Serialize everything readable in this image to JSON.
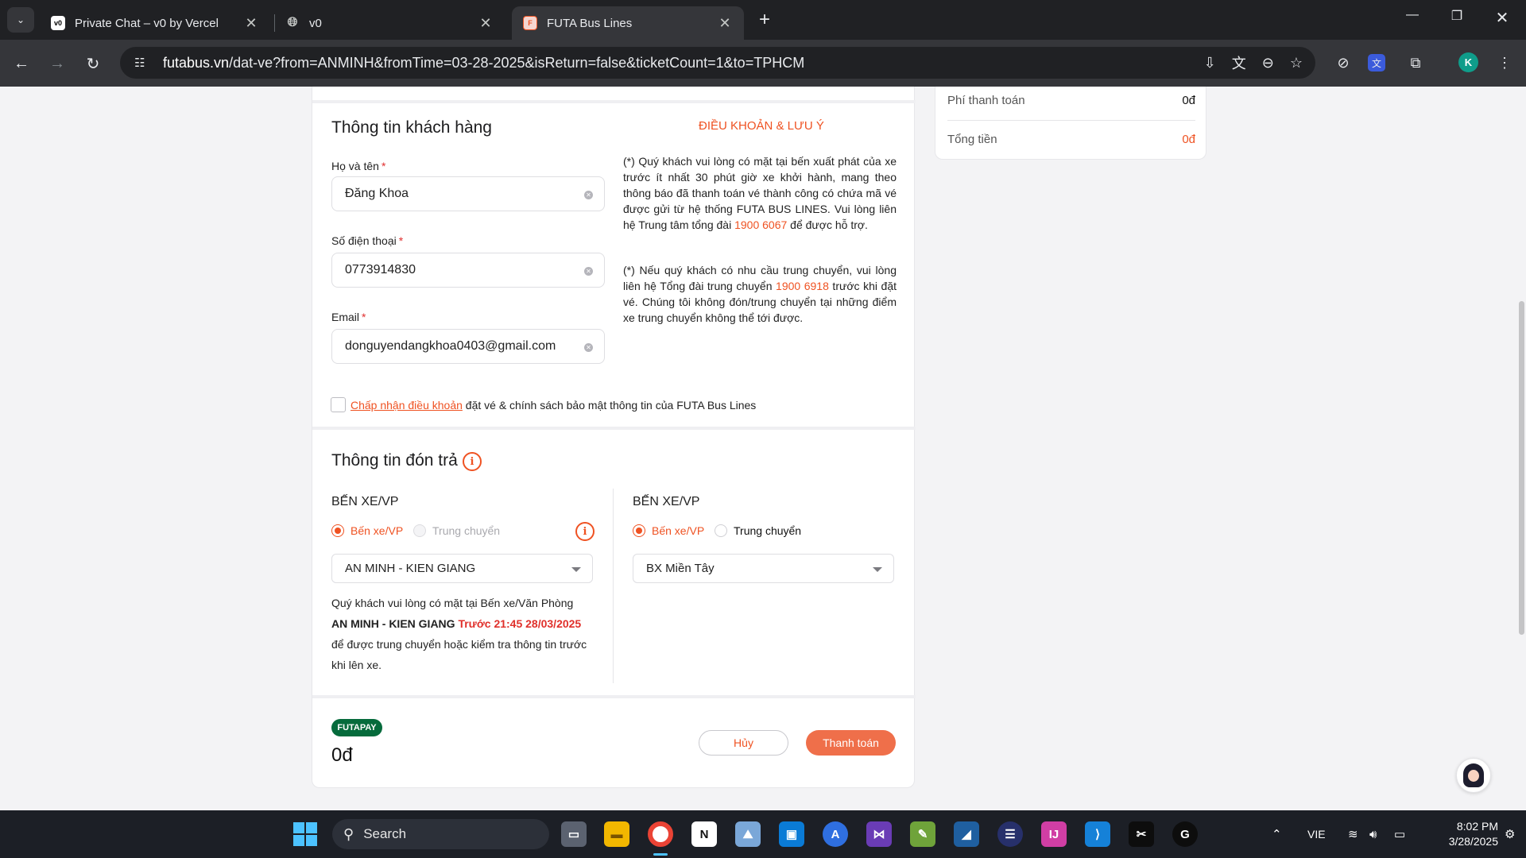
{
  "browser": {
    "tabs": [
      {
        "title": "Private Chat – v0 by Vercel",
        "favicon": "v0",
        "active": false
      },
      {
        "title": "v0",
        "favicon": "globe-icon",
        "active": false
      },
      {
        "title": "FUTA Bus Lines",
        "favicon": "futa-icon",
        "active": true
      }
    ],
    "url_host": "futabus.vn",
    "url_path": "/dat-ve?from=ANMINH&fromTime=03-28-2025&isReturn=false&ticketCount=1&to=TPHCM",
    "profile_initial": "K"
  },
  "customer": {
    "title": "Thông tin khách hàng",
    "name_label": "Họ và tên",
    "name_value": "Đăng Khoa",
    "phone_label": "Số điện thoại",
    "phone_value": "0773914830",
    "email_label": "Email",
    "email_value": "donguyendangkhoa0403@gmail.com",
    "required_mark": "*"
  },
  "terms": {
    "title": "ĐIỀU KHOẢN & LƯU Ý",
    "p1_before": "(*) Quý khách vui lòng có mặt tại bến xuất phát của xe trước ít nhất 30 phút giờ xe khởi hành, mang theo thông báo đã thanh toán vé thành công có chứa mã vé được gửi từ hệ thống FUTA BUS LINES. Vui lòng liên hệ Trung tâm tổng đài ",
    "p1_phone": "1900 6067",
    "p1_after": " để được hỗ trợ.",
    "p2_before": "(*) Nếu quý khách có nhu cầu trung chuyển, vui lòng liên hệ Tổng đài trung chuyển ",
    "p2_phone": "1900 6918",
    "p2_after": " trước khi đặt vé. Chúng tôi không đón/trung chuyển tại những điểm xe trung chuyển không thể tới được.",
    "agree_link": "Chấp nhận điều khoản",
    "agree_rest": " đặt vé & chính sách bảo mật thông tin của FUTA Bus Lines"
  },
  "pickup": {
    "title": "Thông tin đón trả",
    "left": {
      "heading": "BẾN XE/VP",
      "option_station": "Bến xe/VP",
      "option_transfer": "Trung chuyển",
      "selected": "AN MINH - KIEN GIANG",
      "note_line1": "Quý khách vui lòng có mặt tại Bến xe/Văn Phòng",
      "note_station": "AN MINH - KIEN GIANG",
      "note_time": "Trước 21:45 28/03/2025",
      "note_line3": "để được trung chuyển hoặc kiểm tra thông tin trước khi lên xe."
    },
    "right": {
      "heading": "BẾN XE/VP",
      "option_station": "Bến xe/VP",
      "option_transfer": "Trung chuyển",
      "selected": "BX Miền Tây"
    }
  },
  "payment": {
    "badge": "FUTAPAY",
    "amount": "0đ",
    "cancel_label": "Hủy",
    "pay_label": "Thanh toán"
  },
  "summary": {
    "fee_label": "Phí thanh toán",
    "fee_value": "0đ",
    "total_label": "Tổng tiền",
    "total_value": "0đ"
  },
  "taskbar": {
    "search_label": "Search",
    "language": "VIE",
    "time": "8:02 PM",
    "date": "3/28/2025"
  },
  "colors": {
    "accent": "#ef5222",
    "futapay_green": "#066b3c",
    "pay_button": "#ef6f4a"
  }
}
